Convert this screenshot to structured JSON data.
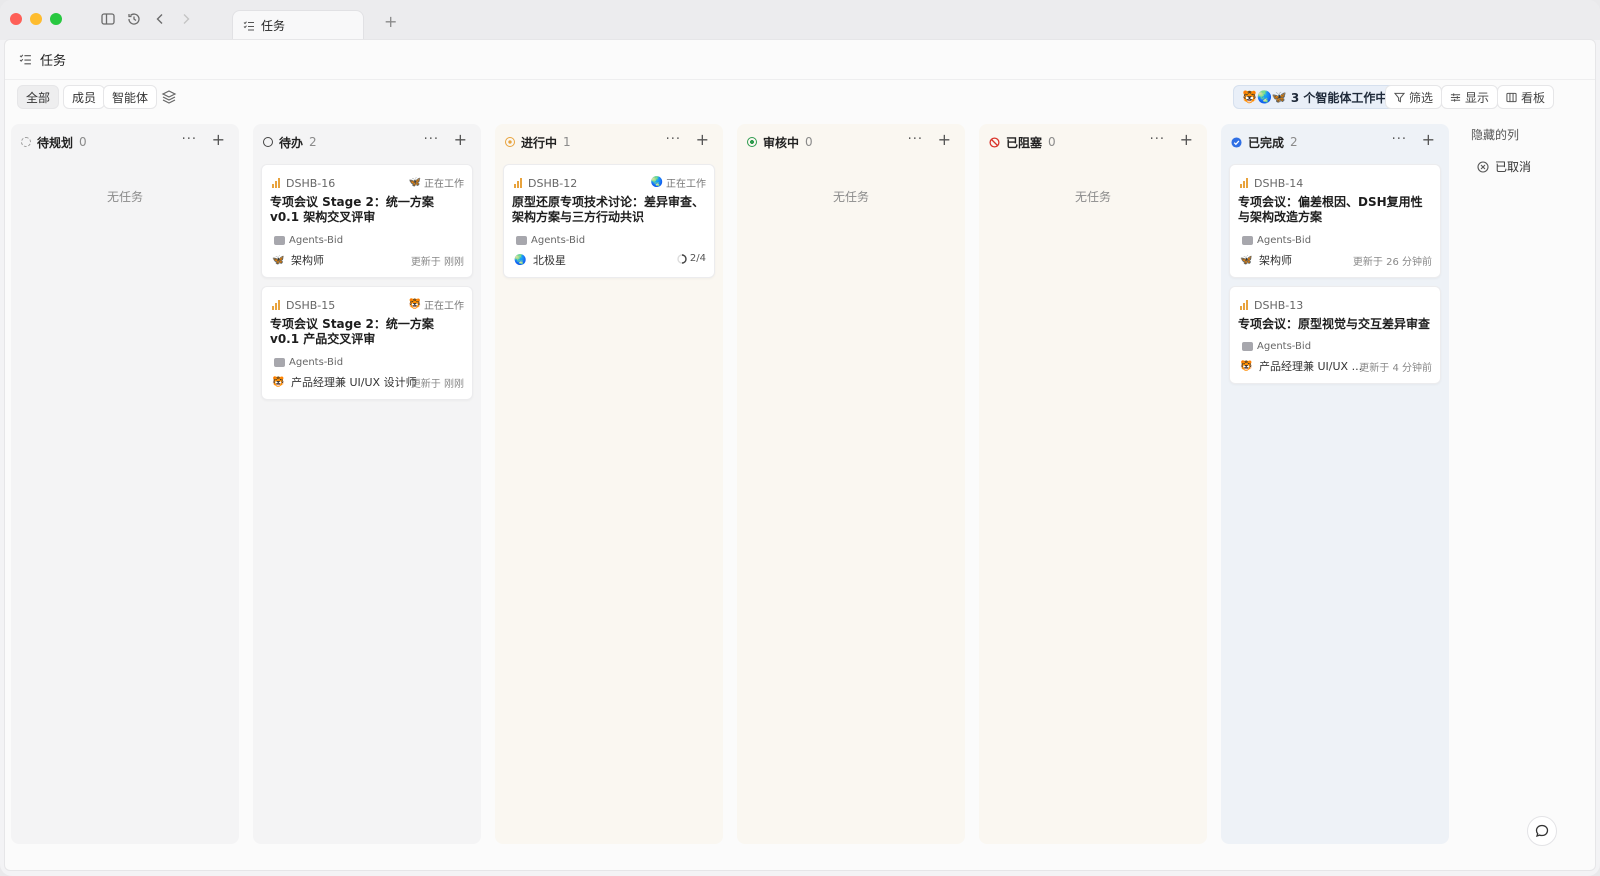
{
  "window": {
    "tab_title": "任务",
    "colors": {
      "red": "#fe5f57",
      "yellow": "#febc2e",
      "green": "#28c840",
      "accent": "#2f6fe4"
    }
  },
  "header": {
    "title": "任务"
  },
  "toolbar": {
    "filters": [
      "全部",
      "成员",
      "智能体"
    ],
    "agents_working": "3 个智能体工作中",
    "filter_label": "筛选",
    "display_label": "显示",
    "board_label": "看板"
  },
  "columns": [
    {
      "title": "待规划",
      "count": "0",
      "empty_text": "无任务",
      "icon": "dashed-circle-icon",
      "bg": "#f4f4f5"
    },
    {
      "title": "待办",
      "count": "2",
      "empty_text": "",
      "icon": "circle-icon",
      "bg": "#f4f4f5"
    },
    {
      "title": "进行中",
      "count": "1",
      "empty_text": "",
      "icon": "in-progress-icon",
      "bg": "#faf7f1"
    },
    {
      "title": "审核中",
      "count": "0",
      "empty_text": "无任务",
      "icon": "review-icon",
      "bg": "#faf7f1"
    },
    {
      "title": "已阻塞",
      "count": "0",
      "empty_text": "无任务",
      "icon": "blocked-icon",
      "bg": "#faf7f1"
    },
    {
      "title": "已完成",
      "count": "2",
      "empty_text": "",
      "icon": "done-check-icon",
      "bg": "#eef2f7"
    }
  ],
  "cards": {
    "c16": {
      "id": "DSHB-16",
      "status": "正在工作",
      "title": "专项会议 Stage 2：统一方案 v0.1 架构交叉评审",
      "project": "Agents-Bid",
      "assignee": "架构师",
      "updated": "更新于 刚刚"
    },
    "c15": {
      "id": "DSHB-15",
      "status": "正在工作",
      "title": "专项会议 Stage 2：统一方案 v0.1 产品交叉评审",
      "project": "Agents-Bid",
      "assignee": "产品经理兼 UI/UX 设计师",
      "updated": "更新于 刚刚"
    },
    "c12": {
      "id": "DSHB-12",
      "status": "正在工作",
      "title": "原型还原专项技术讨论：差异审查、架构方案与三方行动共识",
      "project": "Agents-Bid",
      "assignee": "北极星",
      "progress": "2/4"
    },
    "c14": {
      "id": "DSHB-14",
      "title": "专项会议：偏差根因、DSH复用性与架构改造方案",
      "project": "Agents-Bid",
      "assignee": "架构师",
      "updated": "更新于 26 分钟前"
    },
    "c13": {
      "id": "DSHB-13",
      "title": "专项会议：原型视觉与交互差异审查",
      "project": "Agents-Bid",
      "assignee": "产品经理兼 UI/UX ...",
      "updated": "更新于 4 分钟前"
    }
  },
  "hidden_columns": {
    "label": "隐藏的列",
    "items": [
      "已取消"
    ]
  }
}
